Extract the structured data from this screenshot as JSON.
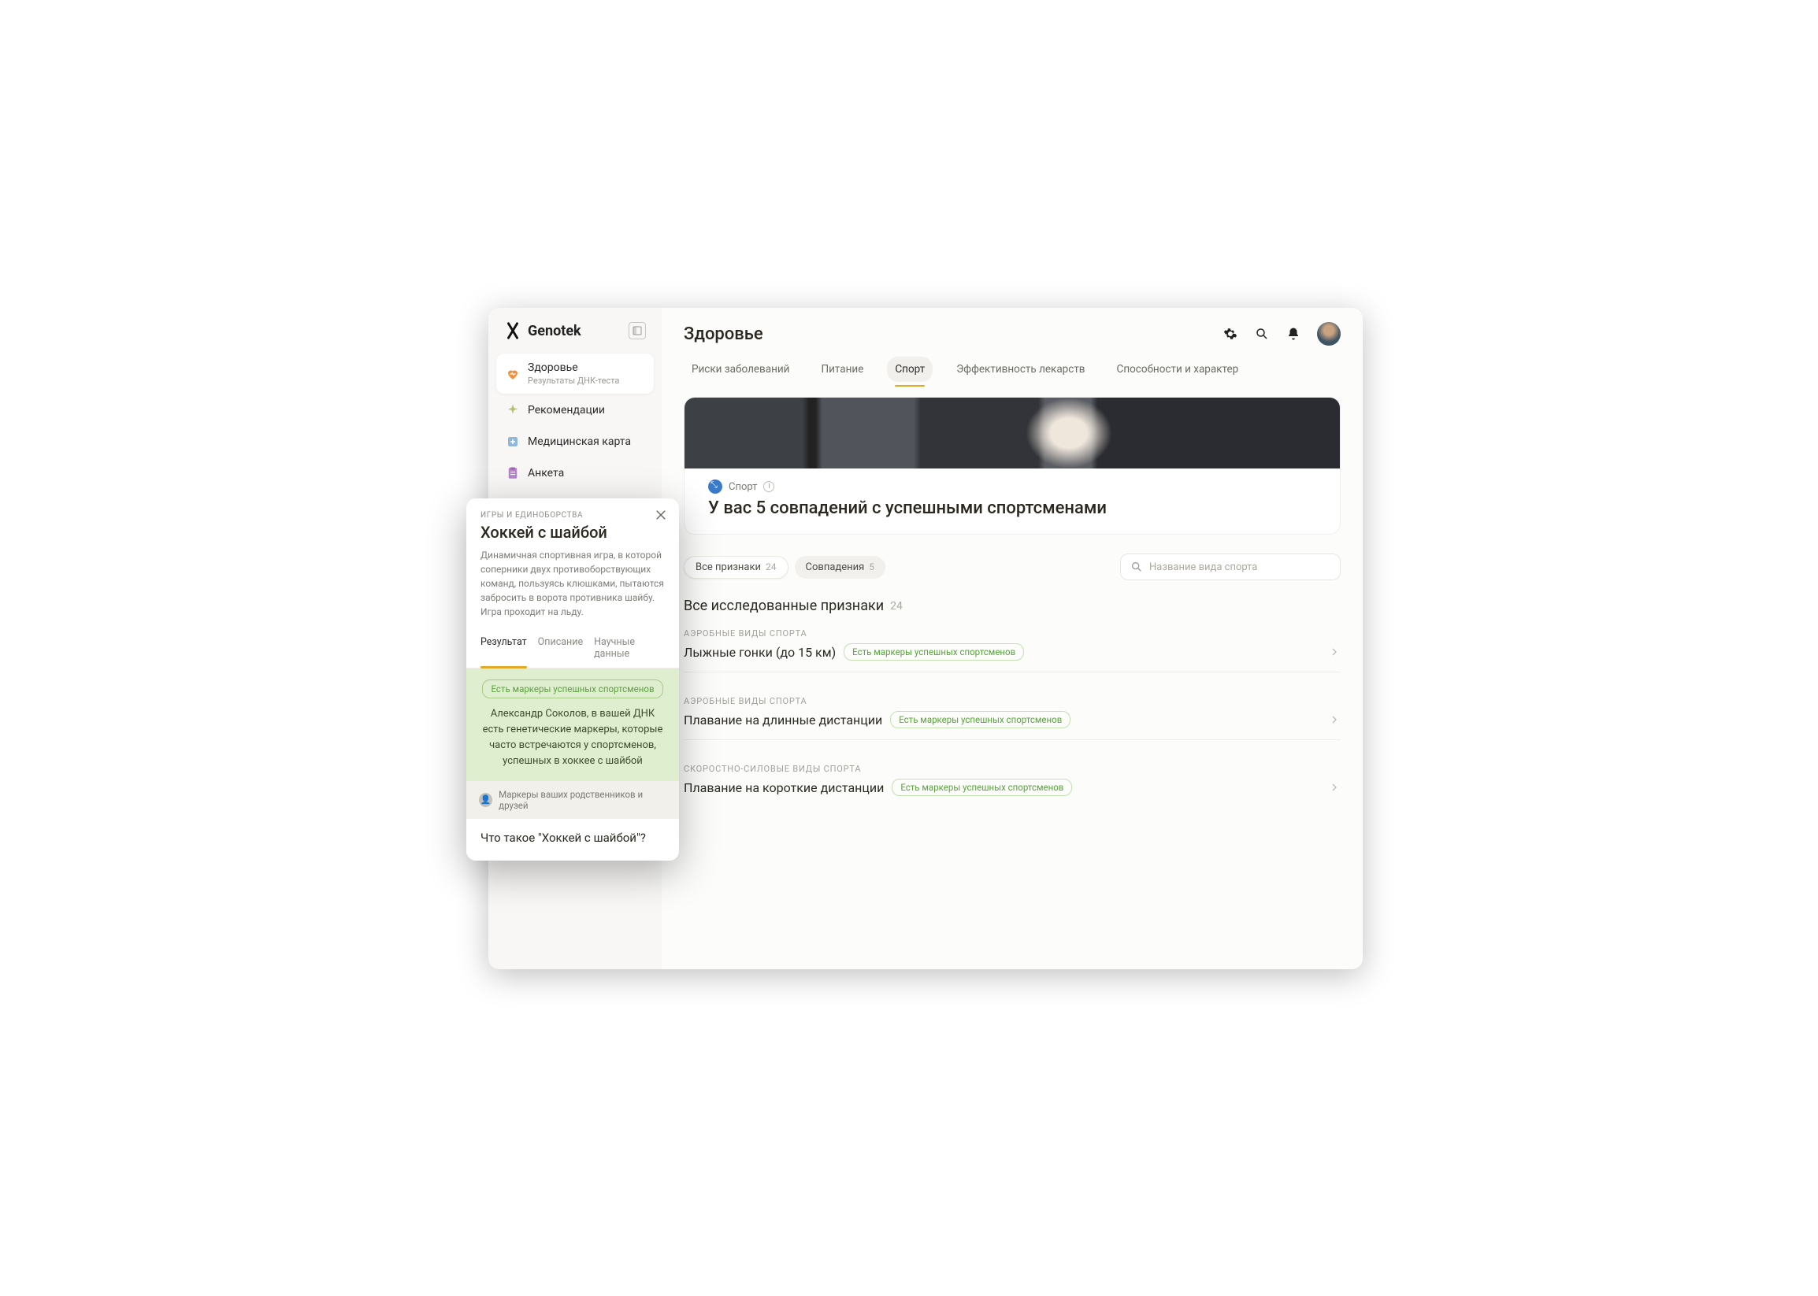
{
  "brand": {
    "name": "Genotek"
  },
  "sidebar": {
    "items": [
      {
        "label": "Здоровье",
        "sublabel": "Результаты ДНК-теста"
      },
      {
        "label": "Рекомендации"
      },
      {
        "label": "Медицинская карта"
      },
      {
        "label": "Анкета"
      }
    ]
  },
  "header": {
    "title": "Здоровье"
  },
  "tabs": [
    {
      "label": "Риски заболеваний"
    },
    {
      "label": "Питание"
    },
    {
      "label": "Спорт"
    },
    {
      "label": "Эффективность лекарств"
    },
    {
      "label": "Способности и характер"
    }
  ],
  "hero": {
    "category": "Спорт",
    "headline": "У вас 5 совпадений с успешными спортсменами"
  },
  "filters": [
    {
      "label": "Все признаки",
      "count": "24"
    },
    {
      "label": "Совпадения",
      "count": "5"
    }
  ],
  "search": {
    "placeholder": "Название вида спорта"
  },
  "section": {
    "title": "Все исследованные признаки",
    "count": "24"
  },
  "badge_text": "Есть маркеры успешных спортсменов",
  "sports": [
    {
      "category": "АЭРОБНЫЕ ВИДЫ СПОРТА",
      "name": "Лыжные гонки (до 15 км)"
    },
    {
      "category": "АЭРОБНЫЕ ВИДЫ СПОРТА",
      "name": "Плавание на длинные дистанции"
    },
    {
      "category": "СКОРОСТНО-СИЛОВЫЕ ВИДЫ СПОРТА",
      "name": "Плавание на короткие дистанции"
    }
  ],
  "overlay": {
    "subheading": "ИГРЫ И ЕДИНОБОРСТВА",
    "title": "Хоккей с шайбой",
    "description": "Динамичная спортивная игра, в которой соперники двух противоборствующих команд, пользуясь клюшками, пытаются забросить в ворота противника шайбу. Игра проходит на льду.",
    "tabs": [
      {
        "label": "Результат"
      },
      {
        "label": "Описание"
      },
      {
        "label": "Научные данные"
      }
    ],
    "badge": "Есть маркеры успешных спортсменов",
    "green_text": "Александр Соколов, в вашей ДНК есть генетические маркеры, которые часто встречаются у спортсменов, успешных в хоккее с шайбой",
    "relatives": "Маркеры ваших родственников и друзей",
    "question": "Что такое \"Хоккей с шайбой\"?"
  }
}
